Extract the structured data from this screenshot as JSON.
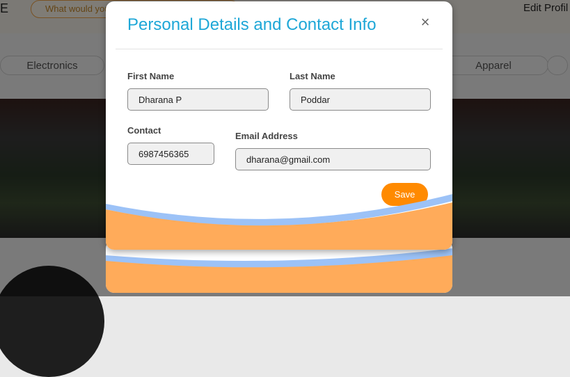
{
  "background": {
    "logo_letter": "E",
    "search_placeholder": "What would you",
    "edit_profile": "Edit Profil",
    "categories": [
      "Electronics",
      "Apparel"
    ]
  },
  "modal": {
    "title": "Personal Details and Contact Info",
    "close_symbol": "×",
    "fields": {
      "first_name": {
        "label": "First Name",
        "value": "Dharana P"
      },
      "last_name": {
        "label": "Last Name",
        "value": "Poddar"
      },
      "contact": {
        "label": "Contact",
        "value": "6987456365"
      },
      "email": {
        "label": "Email Address",
        "value": "dharana@gmail.com"
      }
    },
    "save_label": "Save"
  },
  "colors": {
    "title": "#1ea7d7",
    "save_button": "#ff8a00",
    "wave_orange": "#ffab5a",
    "wave_blue": "#9cc2f7"
  }
}
